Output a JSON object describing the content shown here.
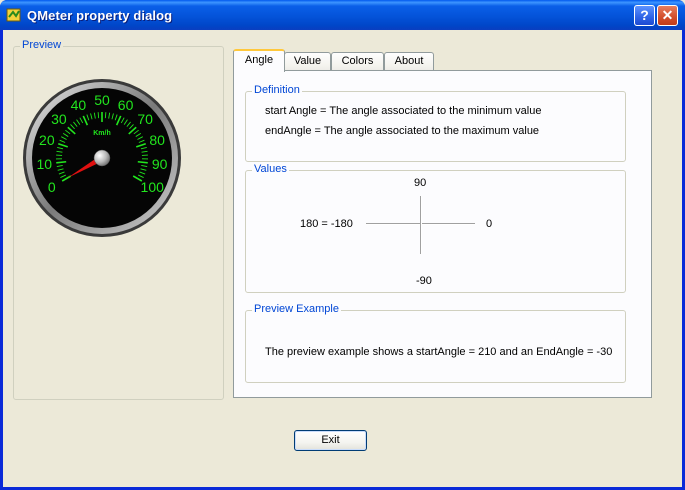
{
  "window": {
    "title": "QMeter property dialog",
    "help_label": "?",
    "close_label": "✕"
  },
  "preview": {
    "group_title": "Preview",
    "gauge": {
      "unit": "Km/h",
      "labels": [
        "0",
        "10",
        "20",
        "30",
        "40",
        "50",
        "60",
        "70",
        "80",
        "90",
        "100"
      ],
      "value": 0,
      "start_angle": 210,
      "end_angle": -30,
      "label_color": "#22e61e",
      "needle_color": "#e01010"
    }
  },
  "tabs": [
    {
      "label": "Angle",
      "active": true
    },
    {
      "label": "Value",
      "active": false
    },
    {
      "label": "Colors",
      "active": false
    },
    {
      "label": "About",
      "active": false
    }
  ],
  "angle_page": {
    "definition": {
      "title": "Definition",
      "line1": "start Angle = The angle associated to the minimum value",
      "line2": "endAngle = The angle associated to the maximum value"
    },
    "values": {
      "title": "Values",
      "top": "90",
      "left": "180 = -180",
      "right": "0",
      "bottom": "-90"
    },
    "example": {
      "title": "Preview Example",
      "text": "The preview example shows a startAngle = 210 and an EndAngle = -30"
    }
  },
  "buttons": {
    "exit": "Exit"
  },
  "colors": {
    "title_bar": "#0453d9",
    "group_title": "#0046d5",
    "dialog_bg": "#ece9d8"
  }
}
